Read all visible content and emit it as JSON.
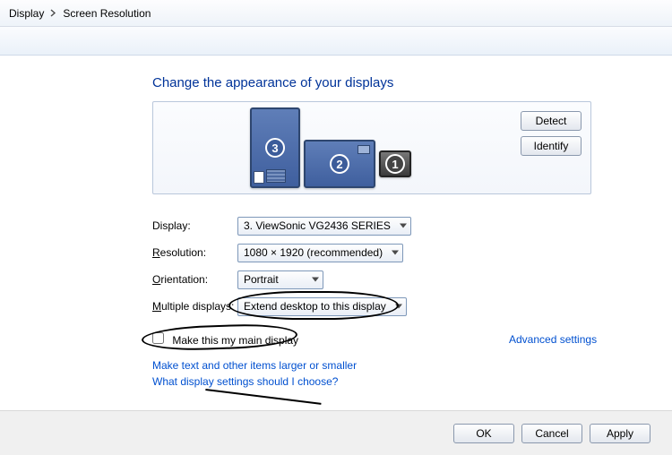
{
  "breadcrumb": {
    "item1": "Display",
    "item2": "Screen Resolution"
  },
  "title": "Change the appearance of your displays",
  "panel_buttons": {
    "detect": "Detect",
    "identify": "Identify"
  },
  "monitors": [
    {
      "num": "3"
    },
    {
      "num": "2"
    },
    {
      "num": "1"
    }
  ],
  "form": {
    "display_label": "Display:",
    "display_value": "3. ViewSonic VG2436 SERIES",
    "resolution_label": "Resolution:",
    "resolution_value": "1080 × 1920 (recommended)",
    "orientation_label": "Orientation:",
    "orientation_value": "Portrait",
    "multi_label": "Multiple displays:",
    "multi_value": "Extend desktop to this display"
  },
  "main_display_checkbox": "Make this my main display",
  "advanced_link": "Advanced settings",
  "links": {
    "l1": "Make text and other items larger or smaller",
    "l2": "What display settings should I choose?"
  },
  "buttons": {
    "ok": "OK",
    "cancel": "Cancel",
    "apply": "Apply"
  }
}
